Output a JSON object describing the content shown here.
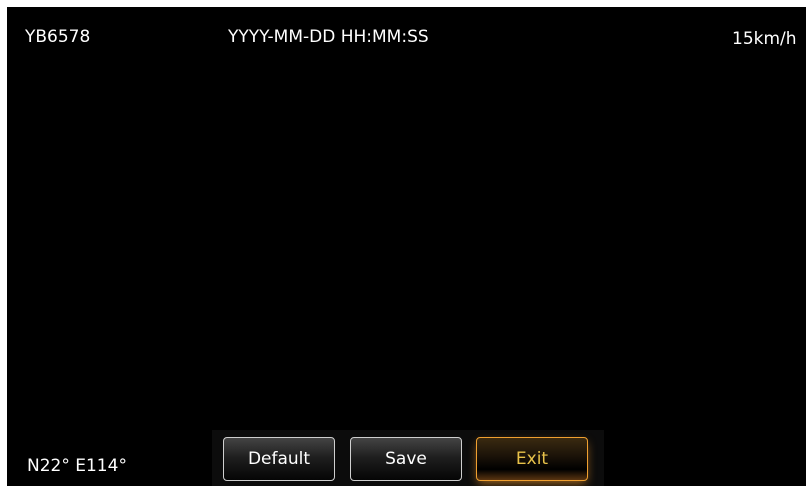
{
  "osd": {
    "plate": "YB6578",
    "datetime": "YYYY-MM-DD HH:MM:SS",
    "speed": "15km/h",
    "gps": "N22° E114°"
  },
  "buttons": {
    "default_label": "Default",
    "save_label": "Save",
    "exit_label": "Exit"
  },
  "colors": {
    "background": "#000000",
    "text": "#ffffff",
    "accent": "#f0a030"
  }
}
